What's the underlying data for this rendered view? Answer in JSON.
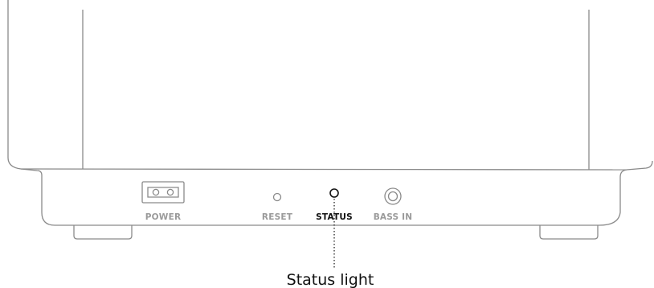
{
  "ports": {
    "power": "POWER",
    "reset": "RESET",
    "status": "STATUS",
    "bass_in": "BASS IN"
  },
  "callout": {
    "label": "Status light"
  }
}
